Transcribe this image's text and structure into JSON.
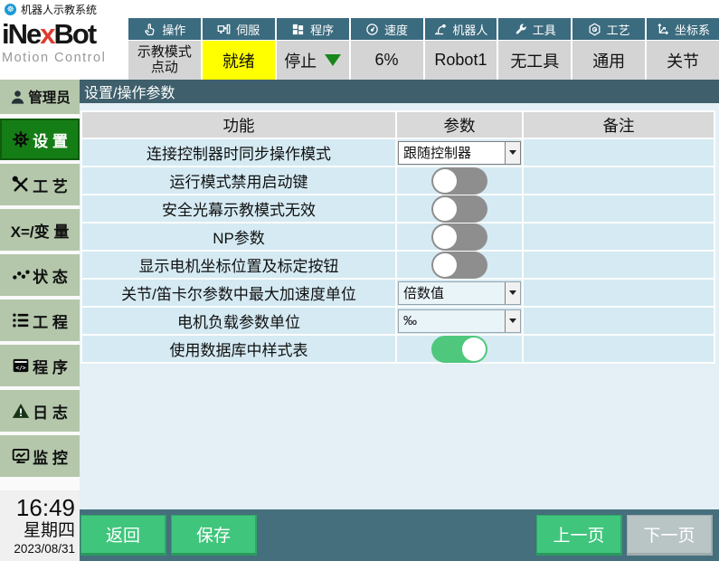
{
  "window": {
    "title": "机器人示教系统"
  },
  "logo": {
    "brand_pre": "iNe",
    "brand_accent": "x",
    "brand_post": "Bot",
    "subtitle": "Motion Control"
  },
  "toolbar": {
    "groups": [
      {
        "icon": "hand-icon",
        "label": "操作",
        "value": "示教模式",
        "value2": "点动"
      },
      {
        "icon": "servo-icon",
        "label": "伺服",
        "value": "就绪",
        "status_color": "#ffff00"
      },
      {
        "icon": "grid-icon",
        "label": "程序",
        "value": "停止",
        "arrow_color": "#17871c"
      },
      {
        "icon": "gauge-icon",
        "label": "速度",
        "value": "6%"
      },
      {
        "icon": "robot-icon",
        "label": "机器人",
        "value": "Robot1"
      },
      {
        "icon": "wrench-icon",
        "label": "工具",
        "value": "无工具"
      },
      {
        "icon": "hexagon-icon",
        "label": "工艺",
        "value": "通用"
      },
      {
        "icon": "axes-icon",
        "label": "坐标系",
        "value": "关节"
      }
    ]
  },
  "sidebar": {
    "user": "管理员",
    "items": [
      {
        "label": "设 置",
        "active": true
      },
      {
        "label": "工 艺"
      },
      {
        "label": "X=/变 量"
      },
      {
        "label": "状 态"
      },
      {
        "label": "工 程"
      },
      {
        "label": "程 序"
      },
      {
        "label": "日 志"
      },
      {
        "label": "监 控"
      }
    ],
    "clock": {
      "time": "16:49",
      "weekday": "星期四",
      "date": "2023/08/31"
    }
  },
  "main": {
    "title": "设置/操作参数",
    "table": {
      "headers": [
        "功能",
        "参数",
        "备注"
      ],
      "rows": [
        {
          "func": "连接控制器时同步操作模式",
          "control": "select",
          "value": "跟随控制器",
          "note": ""
        },
        {
          "func": "运行模式禁用启动键",
          "control": "toggle",
          "state": "off",
          "note": ""
        },
        {
          "func": "安全光幕示教模式无效",
          "control": "toggle",
          "state": "off",
          "note": ""
        },
        {
          "func": "NP参数",
          "control": "toggle",
          "state": "off",
          "note": ""
        },
        {
          "func": "显示电机坐标位置及标定按钮",
          "control": "toggle",
          "state": "off",
          "note": ""
        },
        {
          "func": "关节/笛卡尔参数中最大加速度单位",
          "control": "select",
          "value": "倍数值",
          "note": ""
        },
        {
          "func": "电机负载参数单位",
          "control": "select",
          "value": "‰",
          "note": ""
        },
        {
          "func": "使用数据库中样式表",
          "control": "toggle",
          "state": "on",
          "note": ""
        }
      ]
    },
    "footer": {
      "back": "返回",
      "save": "保存",
      "prev": "上一页",
      "next": "下一页"
    }
  },
  "colors": {
    "toolbar_teal": "#3b6b7e",
    "sidebar_green": "#b4c7ab",
    "active_green": "#157d15",
    "ready_yellow": "#ffff00",
    "row_blue": "#d5eaf3",
    "footer_teal": "#456f7d",
    "button_green": "#40c57c",
    "toggle_on_green": "#4fc87e"
  }
}
